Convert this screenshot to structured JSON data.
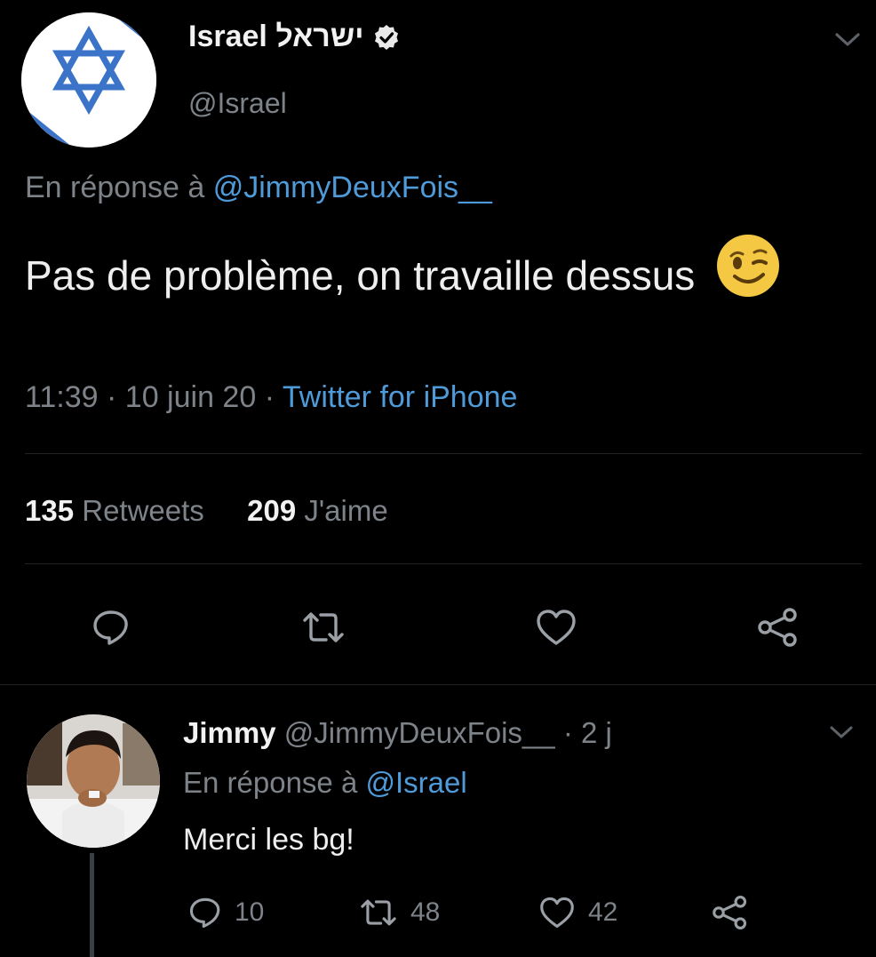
{
  "main_tweet": {
    "display_name": "Israel ישראל",
    "handle": "@Israel",
    "reply_prefix": "En réponse à",
    "reply_to": "@JimmyDeuxFois__",
    "text": "Pas de problème, on travaille dessus",
    "emoji": "winking-face-emoji",
    "time": "11:39",
    "date": "10 juin 20",
    "source": "Twitter for iPhone",
    "retweets_count": "135",
    "retweets_label": "Retweets",
    "likes_count": "209",
    "likes_label": "J'aime"
  },
  "reply_tweet": {
    "display_name": "Jimmy",
    "handle": "@JimmyDeuxFois__",
    "age": "2 j",
    "reply_prefix": "En réponse à",
    "reply_to": "@Israel",
    "text": "Merci les bg!",
    "replies": "10",
    "retweets": "48",
    "likes": "42"
  },
  "colors": {
    "background": "#000000",
    "link": "#4f9bd9",
    "muted": "#7d8389",
    "verified": "#e9e9e9",
    "flag_blue": "#3b73c8",
    "emoji_yellow": "#f4c842"
  }
}
